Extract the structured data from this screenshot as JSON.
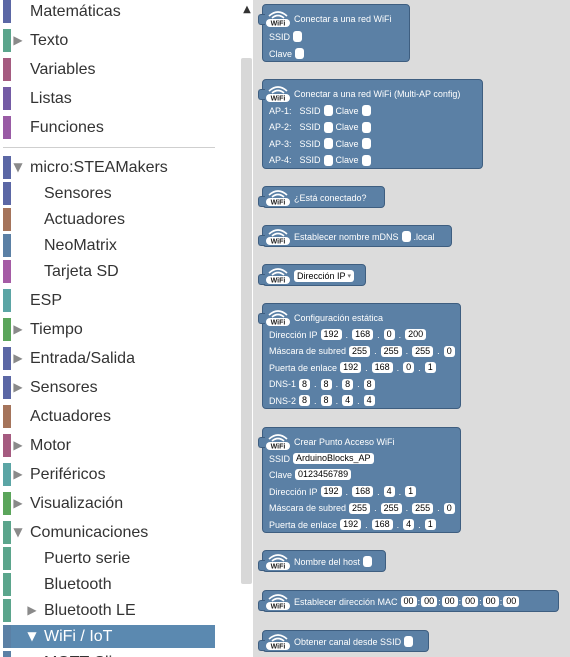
{
  "toolbox": {
    "categories": [
      {
        "label": "Matemáticas",
        "color": "#5b67a5",
        "toggle": ""
      },
      {
        "label": "Texto",
        "color": "#5ba58c",
        "toggle": "▶"
      },
      {
        "label": "Variables",
        "color": "#a55b80",
        "toggle": ""
      },
      {
        "label": "Listas",
        "color": "#745ba5",
        "toggle": ""
      },
      {
        "label": "Funciones",
        "color": "#995ba5",
        "toggle": ""
      },
      {
        "label": "micro:STEAMakers",
        "color": "#5b67a5",
        "toggle": "▼"
      },
      {
        "label": "Sensores",
        "color": "#5b67a5",
        "toggle": ""
      },
      {
        "label": "Actuadores",
        "color": "#a5745b",
        "toggle": ""
      },
      {
        "label": "NeoMatrix",
        "color": "#5b80a5",
        "toggle": ""
      },
      {
        "label": "Tarjeta SD",
        "color": "#a55ba5",
        "toggle": ""
      },
      {
        "label": "ESP",
        "color": "#5ba5a5",
        "toggle": ""
      },
      {
        "label": "Tiempo",
        "color": "#5ba55b",
        "toggle": "▶"
      },
      {
        "label": "Entrada/Salida",
        "color": "#5b67a5",
        "toggle": "▶"
      },
      {
        "label": "Sensores",
        "color": "#5b67a5",
        "toggle": "▶"
      },
      {
        "label": "Actuadores",
        "color": "#a5745b",
        "toggle": ""
      },
      {
        "label": "Motor",
        "color": "#a55b80",
        "toggle": "▶"
      },
      {
        "label": "Periféricos",
        "color": "#5ba5a5",
        "toggle": "▶"
      },
      {
        "label": "Visualización",
        "color": "#5ba55b",
        "toggle": "▶"
      },
      {
        "label": "Comunicaciones",
        "color": "#5ba58c",
        "toggle": "▼"
      },
      {
        "label": "Puerto serie",
        "color": "#5ba58c",
        "toggle": ""
      },
      {
        "label": "Bluetooth",
        "color": "#5ba58c",
        "toggle": ""
      },
      {
        "label": "Bluetooth LE",
        "color": "#5ba58c",
        "toggle": "▶"
      },
      {
        "label": "WiFi / IoT",
        "color": "#5b80a5",
        "toggle": "▼"
      },
      {
        "label": "MQTT Cli",
        "color": "#5b80a5",
        "toggle": ""
      }
    ]
  },
  "flyout": {
    "wifi_connect": {
      "title": "Conectar a una red WiFi",
      "ssid": "SSID",
      "clave": "Clave"
    },
    "wifi_multiap": {
      "title": "Conectar a una red WiFi (Multi-AP config)",
      "rows": [
        {
          "ap": "AP-1:",
          "ssid": "SSID",
          "clave": "Clave"
        },
        {
          "ap": "AP-2:",
          "ssid": "SSID",
          "clave": "Clave"
        },
        {
          "ap": "AP-3:",
          "ssid": "SSID",
          "clave": "Clave"
        },
        {
          "ap": "AP-4:",
          "ssid": "SSID",
          "clave": "Clave"
        }
      ]
    },
    "is_connected": {
      "title": "¿Está conectado?"
    },
    "mdns": {
      "title": "Establecer nombre mDNS",
      "suffix": ".local"
    },
    "ip_dropdown": {
      "value": "Dirección IP",
      "caret": "▾"
    },
    "static_config": {
      "title": "Configuración estática",
      "rows": [
        {
          "label": "Dirección IP",
          "octets": [
            "192",
            "168",
            "0",
            "200"
          ]
        },
        {
          "label": "Máscara de subred",
          "octets": [
            "255",
            "255",
            "255",
            "0"
          ]
        },
        {
          "label": "Puerta de enlace",
          "octets": [
            "192",
            "168",
            "0",
            "1"
          ]
        },
        {
          "label": "DNS-1",
          "octets": [
            "8",
            "8",
            "8",
            "8"
          ]
        },
        {
          "label": "DNS-2",
          "octets": [
            "8",
            "8",
            "4",
            "4"
          ]
        }
      ]
    },
    "access_point": {
      "title": "Crear Punto Acceso WiFi",
      "ssid_label": "SSID",
      "ssid_value": "ArduinoBlocks_AP",
      "clave_label": "Clave",
      "clave_value": "0123456789",
      "rows": [
        {
          "label": "Dirección IP",
          "octets": [
            "192",
            "168",
            "4",
            "1"
          ]
        },
        {
          "label": "Máscara de subred",
          "octets": [
            "255",
            "255",
            "255",
            "0"
          ]
        },
        {
          "label": "Puerta de enlace",
          "octets": [
            "192",
            "168",
            "4",
            "1"
          ]
        }
      ]
    },
    "hostname": {
      "title": "Nombre del host"
    },
    "set_mac": {
      "title": "Establecer dirección MAC",
      "bytes": [
        "00",
        "00",
        "00",
        "00",
        "00",
        "00"
      ]
    },
    "get_channel": {
      "title": "Obtener canal desde SSID"
    },
    "icon_text": "WiFi"
  }
}
